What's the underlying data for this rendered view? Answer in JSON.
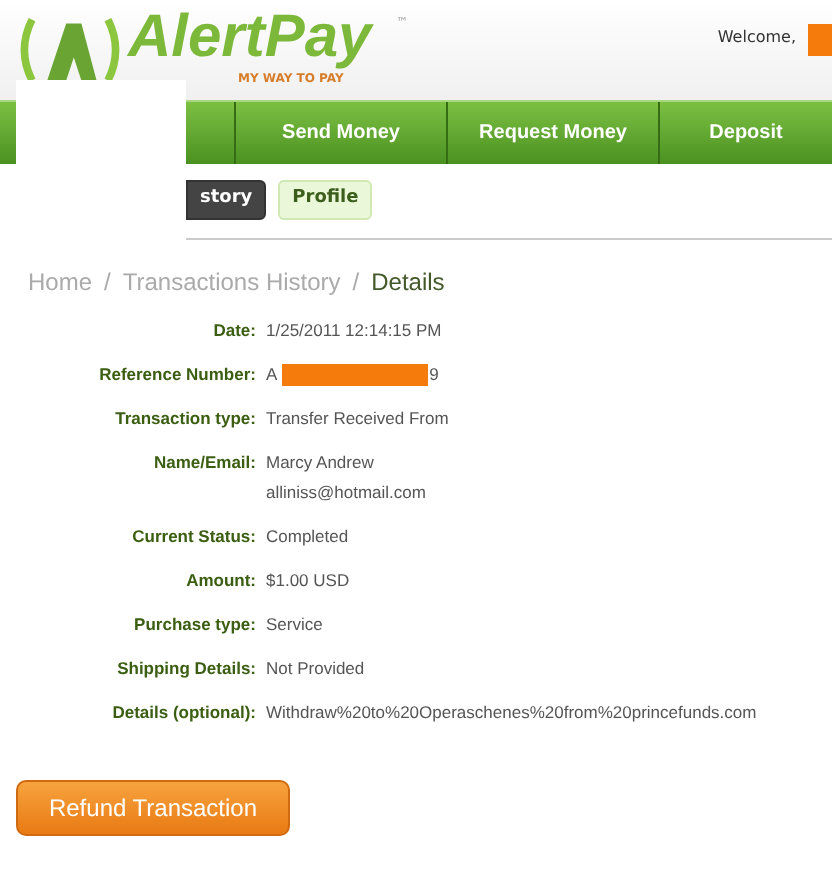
{
  "logo": {
    "name": "AlertPay",
    "trademark": "™",
    "tagline": "MY WAY TO PAY"
  },
  "welcome": {
    "label": "Welcome,"
  },
  "nav": [
    {
      "label": "Send Money"
    },
    {
      "label": "Request Money"
    },
    {
      "label": "Deposit"
    }
  ],
  "subtabs": [
    {
      "label": "story",
      "selected": true
    },
    {
      "label": "Profile",
      "selected": false
    }
  ],
  "breadcrumb": [
    {
      "label": "Home",
      "current": false
    },
    {
      "label": "Transactions History",
      "current": false
    },
    {
      "label": "Details",
      "current": true
    }
  ],
  "separator": "/",
  "details": [
    {
      "label": "Date:",
      "value": [
        "1/25/2011 12:14:15 PM"
      ]
    },
    {
      "label": "Reference Number:",
      "value": [
        "A",
        "9"
      ],
      "kind": "redacted"
    },
    {
      "label": "Transaction type:",
      "value": [
        "Transfer Received From"
      ]
    },
    {
      "label": "Name/Email:",
      "value": [
        "Marcy Andrew",
        "alliniss@hotmail.com"
      ]
    },
    {
      "label": "Current Status:",
      "value": [
        "Completed"
      ]
    },
    {
      "label": "Amount:",
      "value": [
        "$1.00 USD"
      ]
    },
    {
      "label": "Purchase type:",
      "value": [
        "Service"
      ]
    },
    {
      "label": "Shipping Details:",
      "value": [
        "Not Provided"
      ]
    },
    {
      "label": "Details (optional):",
      "value": [
        "Withdraw%20to%20Operaschenes%20from%20princefunds.com"
      ]
    }
  ],
  "refund_button": "Refund Transaction"
}
